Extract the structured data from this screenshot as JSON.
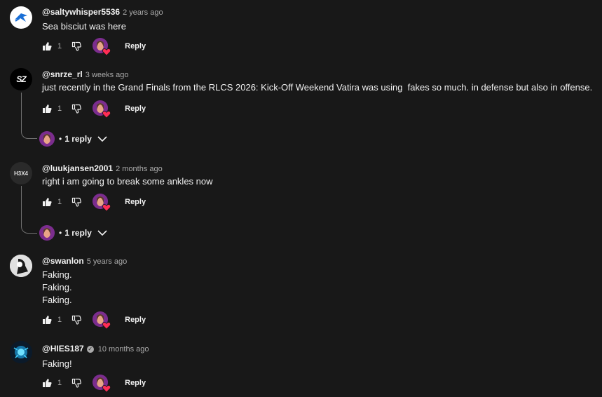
{
  "comments": [
    {
      "author": "@saltywhisper5536",
      "time": "2 years ago",
      "text": "Sea bisciut was here",
      "likes": "1",
      "reply_label": "Reply",
      "avatar_icon": "rocket-league-logo"
    },
    {
      "author": "@snrze_rl",
      "time": "3 weeks ago",
      "text": "just recently in the Grand Finals from the RLCS 2026: Kick-Off Weekend Vatira was using  fakes so much. in defense but also in offense.",
      "likes": "1",
      "reply_label": "Reply",
      "avatar_text": "SZ",
      "replies": "1 reply"
    },
    {
      "author": "@luukjansen2001",
      "time": "2 months ago",
      "text": "right i am going to break some ankles now",
      "likes": "1",
      "reply_label": "Reply",
      "avatar_text": "H3X4",
      "replies": "1 reply"
    },
    {
      "author": "@swanlon",
      "time": "5 years ago",
      "text": "Faking.\nFaking.\nFaking.",
      "likes": "1",
      "reply_label": "Reply"
    },
    {
      "author": "@HIES187",
      "time": "10 months ago",
      "text": "Faking!",
      "likes": "1",
      "reply_label": "Reply",
      "verified": "✓"
    }
  ],
  "colors": {
    "background": "#181818",
    "text": "#f1f1f1",
    "muted": "#aaaaaa",
    "heart": "#ff2d55"
  }
}
